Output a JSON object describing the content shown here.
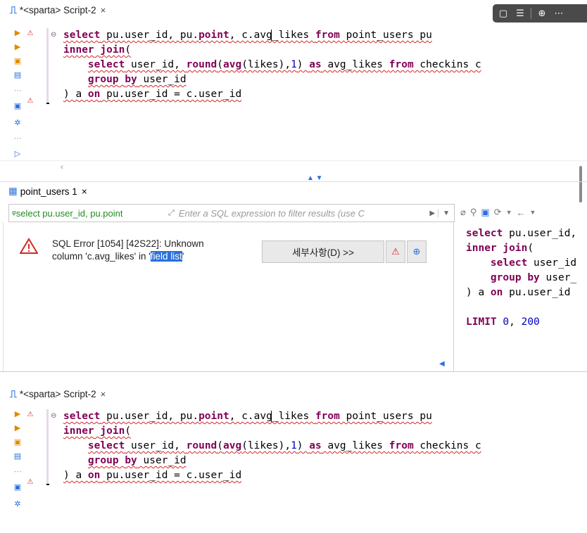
{
  "editor_tab": {
    "icon": "sql-script-icon",
    "title": "*<sparta> Script-2",
    "close_glyph": "×"
  },
  "overlay_tools": [
    "comment-icon",
    "list-icon",
    "download-icon",
    "more-icon"
  ],
  "code_lines": [
    "select pu.user_id, pu.point, c.avg_likes from point_users pu",
    "inner join(",
    "    select user_id, round(avg(likes),1) as avg_likes from checkins c",
    "    group by user_id",
    ") a on pu.user_id = c.user_id"
  ],
  "result_tab": {
    "title": "point_users 1",
    "close_glyph": "×"
  },
  "filter": {
    "sql_prefix": "select pu.user_id, pu.point",
    "placeholder": "Enter a SQL expression to filter results (use C"
  },
  "error": {
    "line1": "SQL Error [1054] [42S22]: Unknown",
    "line2_prefix": "column 'c.avg_likes' in '",
    "line2_highlight": "field list",
    "line2_suffix": "'"
  },
  "details_button": "세부사항(D) >>",
  "sql_preview_lines": [
    "select pu.user_id,",
    "inner join(",
    "    select user_id",
    "    group by user_",
    ") a on pu.user_id",
    "",
    "LIMIT 0, 200"
  ],
  "colors": {
    "keyword": "#7f0055",
    "number": "#0000c0",
    "error_red": "#d12828",
    "highlight_blue": "#2a6fdb",
    "filter_green": "#228b22"
  }
}
